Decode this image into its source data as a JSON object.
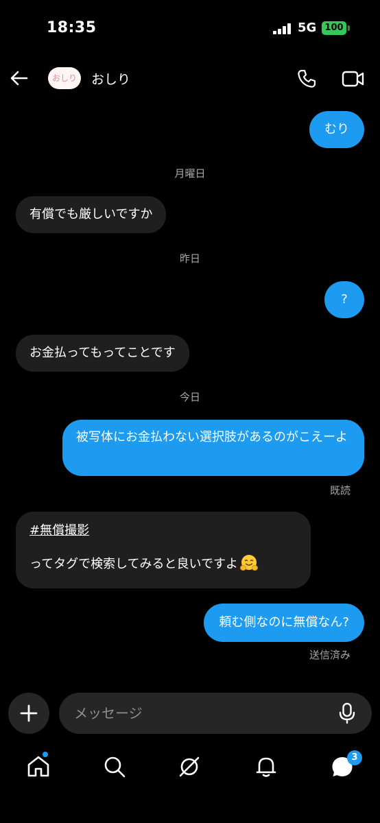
{
  "status_bar": {
    "time": "18:35",
    "network": "5G",
    "battery": "100"
  },
  "header": {
    "avatar_text": "おしり",
    "contact_name": "おしり"
  },
  "colors": {
    "outgoing_bubble": "#1c9bf0",
    "incoming_bubble": "#1f1f1f",
    "background": "#000000",
    "battery": "#34c759"
  },
  "messages": [
    {
      "type": "out",
      "text": "むり"
    },
    {
      "type": "date",
      "text": "月曜日"
    },
    {
      "type": "in",
      "text": "有償でも厳しいですか"
    },
    {
      "type": "date",
      "text": "昨日"
    },
    {
      "type": "out",
      "text": "?"
    },
    {
      "type": "in",
      "text": "お金払ってもってことです"
    },
    {
      "type": "date",
      "text": "今日"
    },
    {
      "type": "out",
      "text": "被写体にお金払わない選択肢があるのがこえーよ"
    },
    {
      "type": "receipt",
      "text": "既読"
    },
    {
      "type": "in",
      "hashtag": "#無償撮影",
      "text": "ってタグで検索してみると良いですよ",
      "emoji": "hugging-face"
    },
    {
      "type": "out",
      "text": "頼む側なのに無償なん?"
    },
    {
      "type": "receipt",
      "text": "送信済み"
    }
  ],
  "composer": {
    "placeholder": "メッセージ",
    "plus_icon": "plus-icon",
    "mic_icon": "microphone-icon"
  },
  "bottom_nav": {
    "items": [
      "home-icon",
      "search-icon",
      "explore-icon",
      "notifications-icon",
      "messages-icon"
    ],
    "messages_badge": "3"
  }
}
